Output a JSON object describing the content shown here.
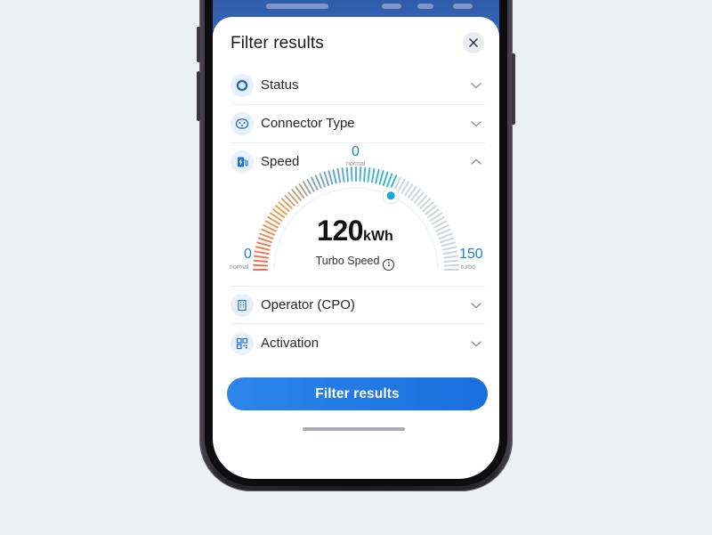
{
  "sheet": {
    "title": "Filter results",
    "close_icon": "close-icon"
  },
  "filters": [
    {
      "label": "Status",
      "icon": "status-ring-icon",
      "expanded": false
    },
    {
      "label": "Connector Type",
      "icon": "connector-plug-icon",
      "expanded": false
    },
    {
      "label": "Speed",
      "icon": "charging-station-icon",
      "expanded": true
    },
    {
      "label": "Operator (CPO)",
      "icon": "building-icon",
      "expanded": false
    },
    {
      "label": "Activation",
      "icon": "qr-code-icon",
      "expanded": false
    }
  ],
  "speed_gauge": {
    "value": "120",
    "unit": "kWh",
    "value_fraction": 0.8,
    "subtitle": "Turbo Speed",
    "left_tick": {
      "value": "0",
      "caption": "normal"
    },
    "top_tick": {
      "value": "0",
      "caption": "normal"
    },
    "right_tick": {
      "value": "150",
      "caption": "turbo"
    },
    "gradient_colors": [
      "#ef6a5a",
      "#e6a65a",
      "#6aa7d6",
      "#2ec1c7"
    ],
    "inactive_color": "#cfd5dc",
    "knob_color": "#1aa6e0"
  },
  "cta": {
    "label": "Filter results"
  },
  "colors": {
    "accent": "#1f78e2",
    "icon_bg": "#e8f0fa",
    "icon_fg": "#1e6fcf"
  }
}
